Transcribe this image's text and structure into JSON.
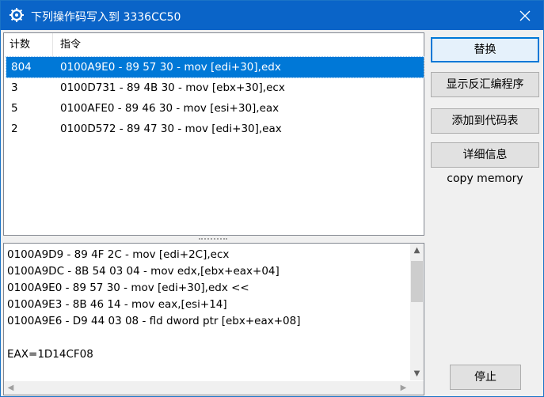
{
  "window": {
    "title": "下列操作码写入到 3336CC50",
    "close_icon": "close-icon",
    "app_icon": "gear-icon"
  },
  "list": {
    "columns": [
      "计数",
      "指令"
    ],
    "rows": [
      {
        "count": "804",
        "instruction": "0100A9E0 - 89 57 30  - mov [edi+30],edx",
        "selected": true
      },
      {
        "count": "3",
        "instruction": "0100D731 - 89 4B 30  - mov [ebx+30],ecx",
        "selected": false
      },
      {
        "count": "5",
        "instruction": "0100AFE0 - 89 46 30  - mov [esi+30],eax",
        "selected": false
      },
      {
        "count": "2",
        "instruction": "0100D572 - 89 47 30  - mov [edi+30],eax",
        "selected": false
      }
    ]
  },
  "disasm": {
    "lines": [
      "0100A9D9 - 89 4F 2C  - mov [edi+2C],ecx",
      "0100A9DC - 8B 54 03 04  - mov edx,[ebx+eax+04]",
      "0100A9E0 - 89 57 30  - mov [edi+30],edx <<",
      "0100A9E3 - 8B 46 14  - mov eax,[esi+14]",
      "0100A9E6 - D9 44 03 08  - fld dword ptr [ebx+eax+08]",
      "",
      "EAX=1D14CF08"
    ]
  },
  "buttons": {
    "replace": "替换",
    "show_disasm": "显示反汇编程序",
    "add_to_codelist": "添加到代码表",
    "details": "详细信息",
    "stop": "停止"
  },
  "copy_memory": "copy memory",
  "colors": {
    "titlebar": "#0a64c8",
    "selection": "#0078d7"
  }
}
